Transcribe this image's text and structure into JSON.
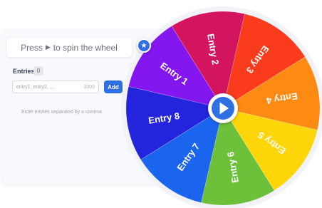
{
  "hint": {
    "prefix": "Press",
    "glyph": "▶",
    "suffix": "to spin the wheel"
  },
  "favorite_icon": "star-icon",
  "entries_panel": {
    "label": "Entries",
    "count": "0",
    "input_value": "entry1, entry2, ...",
    "char_count": "3900",
    "add_label": "Add",
    "helper": "Enter entries separated by a comma"
  },
  "wheel": {
    "spin_icon": "play-icon",
    "segments": [
      {
        "label": "Entry 1",
        "color": "#8416f0"
      },
      {
        "label": "Entry 2",
        "color": "#d3145e"
      },
      {
        "label": "Entry 3",
        "color": "#fa3c1c"
      },
      {
        "label": "Entry 4",
        "color": "#fd8a13"
      },
      {
        "label": "Entry 5",
        "color": "#ffd609"
      },
      {
        "label": "Entry 6",
        "color": "#6cc03a"
      },
      {
        "label": "Entry 7",
        "color": "#1a64ee"
      },
      {
        "label": "Entry 8",
        "color": "#2324db"
      }
    ]
  },
  "colors": {
    "accent": "#2f6fe4",
    "panel_bg": "#f8f9fc"
  }
}
